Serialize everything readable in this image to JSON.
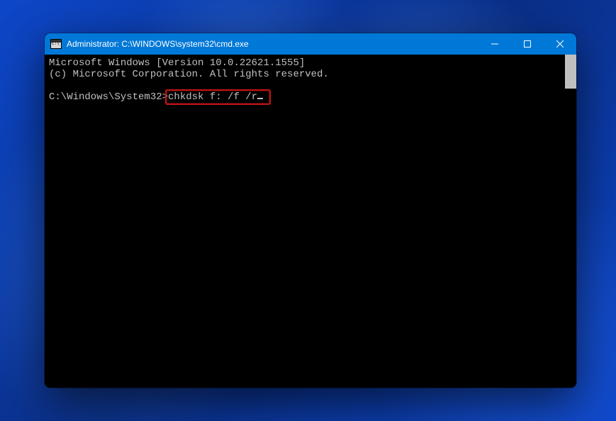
{
  "window": {
    "title": "Administrator: C:\\WINDOWS\\system32\\cmd.exe"
  },
  "terminal": {
    "line1": "Microsoft Windows [Version 10.0.22621.1555]",
    "line2": "(c) Microsoft Corporation. All rights reserved.",
    "prompt": "C:\\Windows\\System32>",
    "command": "chkdsk f: /f /r"
  }
}
